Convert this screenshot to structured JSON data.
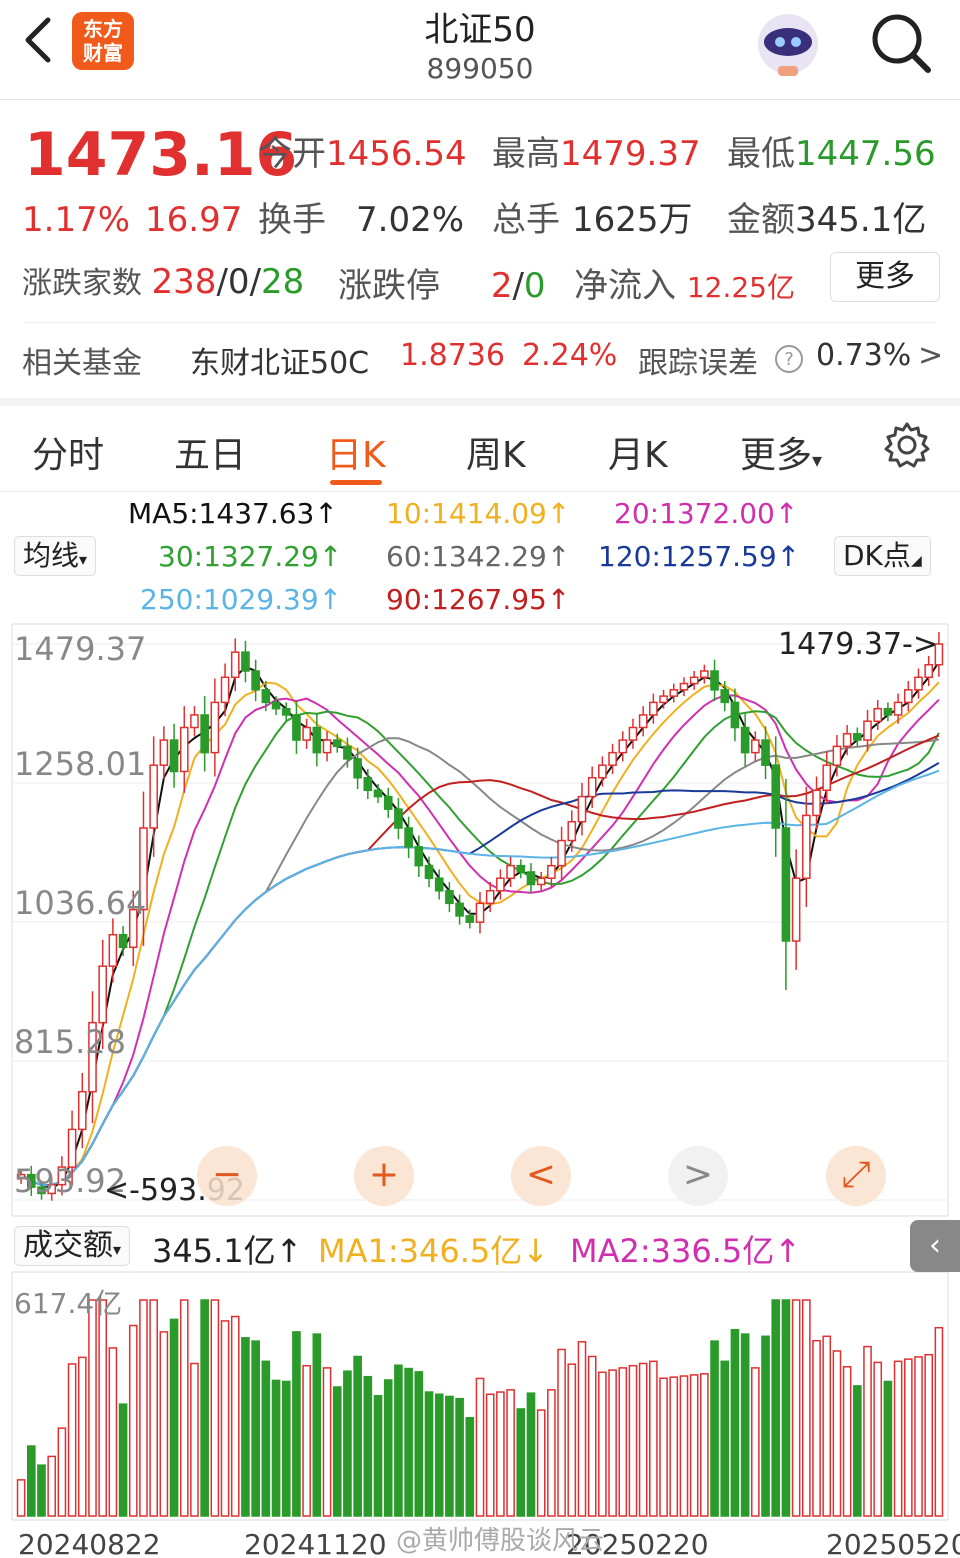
{
  "header": {
    "title": "北证50",
    "code": "899050",
    "logo_line1": "东方",
    "logo_line2": "财富"
  },
  "quote": {
    "price": "1473.16",
    "pct": "1.17%",
    "change": "16.97",
    "open_label": "今开",
    "open": "1456.54",
    "high_label": "最高",
    "high": "1479.37",
    "low_label": "最低",
    "low": "1447.56",
    "turnover_label": "换手",
    "turnover": "7.02%",
    "volume_label": "总手",
    "volume": "1625万",
    "amount_label": "金额",
    "amount": "345.1亿",
    "breadth_label": "涨跌家数",
    "breadth_up": "238",
    "breadth_flat": "0",
    "breadth_down": "28",
    "slash": "/",
    "limit_label": "涨跌停",
    "limit_up": "2",
    "limit_down": "0",
    "netflow_label": "净流入",
    "netflow": "12.25亿",
    "more": "更多"
  },
  "fund": {
    "label": "相关基金",
    "name": "东财北证50C",
    "nav": "1.8736",
    "pct": "2.24%",
    "track_label": "跟踪误差",
    "track_value": "0.73%",
    "help": "?",
    "arrow": ">"
  },
  "tabs": [
    {
      "label": "分时"
    },
    {
      "label": "五日"
    },
    {
      "label": "日K"
    },
    {
      "label": "周K"
    },
    {
      "label": "月K"
    },
    {
      "label": "更多"
    }
  ],
  "ma_legend": {
    "chip": "均线",
    "dk_chip": "DK点",
    "ma5": "MA5:1437.63↑",
    "ma10": "10:1414.09↑",
    "ma20": "20:1372.00↑",
    "ma30": "30:1327.29↑",
    "ma60": "60:1342.29↑",
    "ma120": "120:1257.59↑",
    "ma250": "250:1029.39↑",
    "ma90": "90:1267.95↑"
  },
  "colors": {
    "up": "#e03030",
    "down": "#2a9a2a",
    "ma5": "#111111",
    "ma10": "#f0b020",
    "ma20": "#d030b0",
    "ma30": "#30a030",
    "ma60": "#888888",
    "ma120": "#1a3a9a",
    "ma250": "#5ab4e6",
    "ma90": "#c02020",
    "accent": "#f05a1a"
  },
  "price_axis": {
    "labels": [
      "1479.37",
      "1258.01",
      "1036.64",
      "815.28",
      "593.92"
    ],
    "hi_marker": "1479.37->",
    "lo_marker": "<-593.92"
  },
  "volume_panel": {
    "chip": "成交额",
    "amount": "345.1亿↑",
    "ma1": "MA1:346.5亿↓",
    "ma2": "MA2:336.5亿↑",
    "axis_top": "617.4亿"
  },
  "controls": [
    "−",
    "+",
    "<",
    ">",
    "⤢"
  ],
  "dates": [
    "20240822",
    "20241120",
    "20250220",
    "20250520"
  ],
  "watermark": "@黄帅傅股谈风云",
  "chart_data": {
    "type": "candlestick",
    "y_range": [
      593.92,
      1479.37
    ],
    "closes": [
      628,
      608,
      598,
      612,
      640,
      700,
      760,
      870,
      960,
      1010,
      990,
      1050,
      1180,
      1280,
      1320,
      1270,
      1340,
      1360,
      1300,
      1380,
      1420,
      1460,
      1430,
      1400,
      1380,
      1370,
      1360,
      1320,
      1340,
      1300,
      1320,
      1310,
      1290,
      1260,
      1240,
      1230,
      1210,
      1180,
      1150,
      1120,
      1100,
      1080,
      1060,
      1040,
      1030,
      1060,
      1080,
      1100,
      1120,
      1110,
      1090,
      1100,
      1120,
      1160,
      1190,
      1230,
      1260,
      1280,
      1300,
      1320,
      1340,
      1360,
      1380,
      1390,
      1400,
      1410,
      1420,
      1430,
      1400,
      1380,
      1340,
      1300,
      1320,
      1280,
      1180,
      1000,
      1100,
      1200,
      1240,
      1280,
      1310,
      1330,
      1320,
      1350,
      1370,
      1360,
      1380,
      1400,
      1420,
      1440,
      1473
    ]
  }
}
